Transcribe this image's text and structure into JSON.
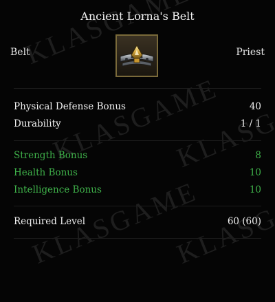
{
  "item": {
    "name": "Ancient Lorna's Belt",
    "type": "Belt",
    "class": "Priest",
    "icon": "belt-icon"
  },
  "watermark": "KLASGAME",
  "base_stats": [
    {
      "label": "Physical Defense Bonus",
      "value": "40"
    },
    {
      "label": "Durability",
      "value": "1 / 1"
    }
  ],
  "bonus_stats": [
    {
      "label": "Strength Bonus",
      "value": "8"
    },
    {
      "label": "Health Bonus",
      "value": "10"
    },
    {
      "label": "Intelligence Bonus",
      "value": "10"
    }
  ],
  "requirements": [
    {
      "label": "Required Level",
      "value": "60 (60)"
    }
  ],
  "colors": {
    "background": "#050505",
    "title": "#f2f2f2",
    "stat_text": "#f0f0f0",
    "bonus_text": "#3fb24a",
    "icon_border": "#7a6a3a"
  }
}
